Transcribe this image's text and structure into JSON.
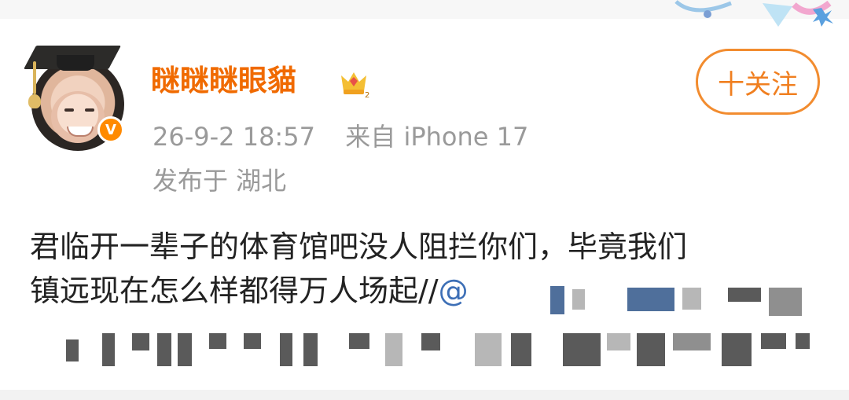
{
  "profile": {
    "username": "瞇瞇瞇眼貓",
    "timestamp": "26-9-2 18:57",
    "source": "来自 iPhone 17",
    "location": "发布于 湖北",
    "verified_mark": "V",
    "avatar_icon": "graduation-cap-avatar"
  },
  "actions": {
    "follow_label": "十关注"
  },
  "post": {
    "line1": "君临开一辈子的体育馆吧没人阻拦你们，毕竟我们",
    "line2_prefix": "镇远现在怎么样都得万人场起//",
    "mention": "@"
  },
  "colors": {
    "username": "#f06a00",
    "meta": "#9a9a9a",
    "follow_border": "#f28c2f",
    "text": "#222222",
    "mention": "#3d6fb6"
  }
}
